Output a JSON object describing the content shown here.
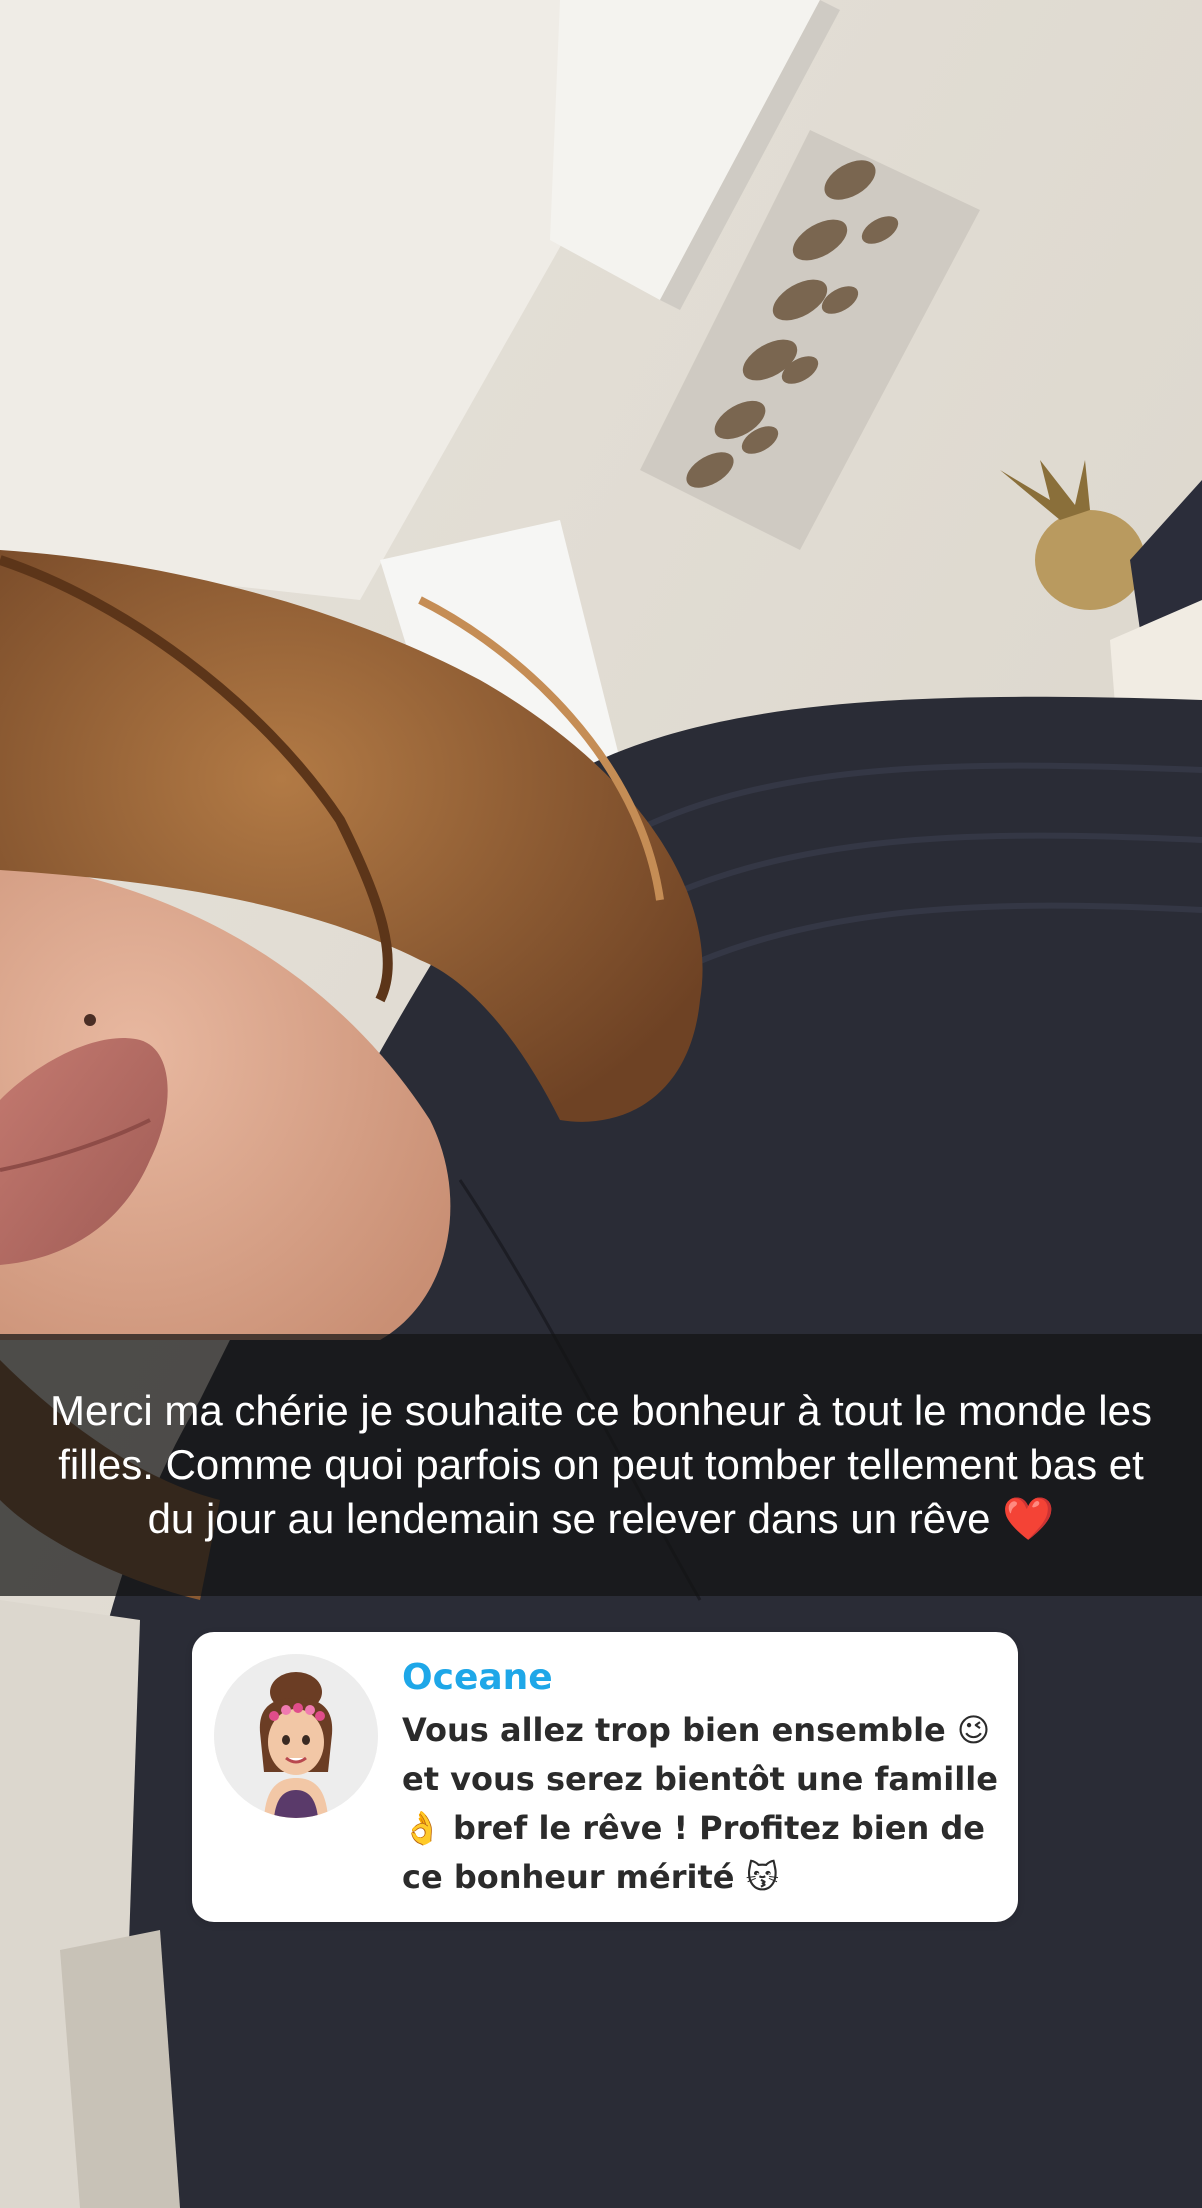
{
  "caption": {
    "text": "Merci ma chérie je souhaite ce bonheur à tout le monde les filles. Comme quoi parfois on peut tomber tellement bas et du jour au lendemain se relever dans un rêve ❤️"
  },
  "reply": {
    "name": "Oceane",
    "message": "Vous allez trop bien ensemble 😉et vous serez bientôt une famille 👌 bref le rêve ! Profitez bien de ce bonheur mérité 😽",
    "avatar_icon": "bitmoji-avatar-icon",
    "name_color": "#1ea7e8"
  },
  "colors": {
    "wall": "#e9e5dd",
    "sweater": "#2a2c36",
    "hair": "#8a5a32",
    "lips": "#b86e66"
  }
}
